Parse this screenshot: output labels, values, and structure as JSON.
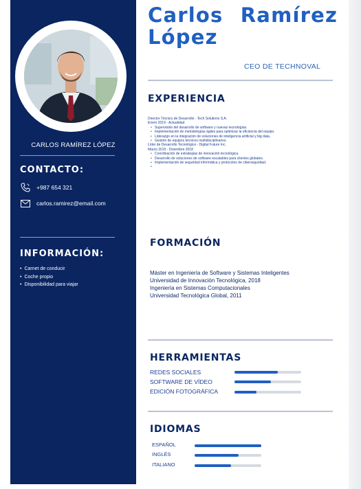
{
  "sidebar": {
    "name": "CARLOS RAMÍREZ LÓPEZ",
    "contact_heading": "CONTACTO:",
    "phone": "+987 654 321",
    "email": "carlos.ramirez@email.com",
    "info_heading": "INFORMACIÓN:",
    "info_items": [
      "Carnet de conducir",
      "Coche propio",
      "Disponibilidad para viajar"
    ],
    "colors": {
      "sidebar_bg": "#0a2560",
      "text": "#ffffff"
    }
  },
  "header": {
    "name_line1": "Carlos Ramírez",
    "name_line2": "López",
    "job_title": "CEO DE TECHNOVAL",
    "accent_color": "#2060c0"
  },
  "experience": {
    "heading": "EXPERIENCIA",
    "jobs": [
      {
        "role": "Director Técnico de Desarrollo - Tech Solutions S.A.",
        "dates": "Enero 2019 - Actualidad",
        "bullets": [
          "Supervisión del desarrollo de software y nuevas tecnologías.",
          "Implementación de metodologías ágiles para optimizar la eficiencia del equipo.",
          "Liderazgo en la integración de soluciones de inteligencia artificial y big data.",
          "Gestión de equipos técnicos multidisciplinarios."
        ]
      },
      {
        "role": "Líder de Desarrollo Tecnológico - Digital Future Inc.",
        "dates": "Marzo 2015 - Diciembre 2018",
        "bullets": [
          "Coordinación de estrategias de innovación tecnológica.",
          "Desarrollo de soluciones de software escalables para clientes globales.",
          "Implementación de seguridad informática y protocolos de ciberseguridad.",
          ""
        ]
      }
    ]
  },
  "education": {
    "heading": "FORMACIÓN",
    "lines": [
      "Máster en Ingeniería de Software y Sistemas Inteligentes",
      "Universidad de Innovación Tecnológica, 2018",
      "Ingeniería en Sistemas Computacionales",
      "Universidad Tecnológica Global, 2011"
    ]
  },
  "tools": {
    "heading": "HERRAMIENTAS",
    "items": [
      {
        "label": "REDES SOCIALES",
        "level": 0.65
      },
      {
        "label": "SOFTWARE DE VÍDEO",
        "level": 0.55
      },
      {
        "label": "EDICIÓN FOTOGRÁFICA",
        "level": 0.33
      }
    ]
  },
  "languages": {
    "heading": "IDIOMAS",
    "items": [
      {
        "label": "ESPAÑOL",
        "level": 1.0
      },
      {
        "label": "INGLÉS",
        "level": 0.66
      },
      {
        "label": "ITALIANO",
        "level": 0.55
      }
    ]
  }
}
